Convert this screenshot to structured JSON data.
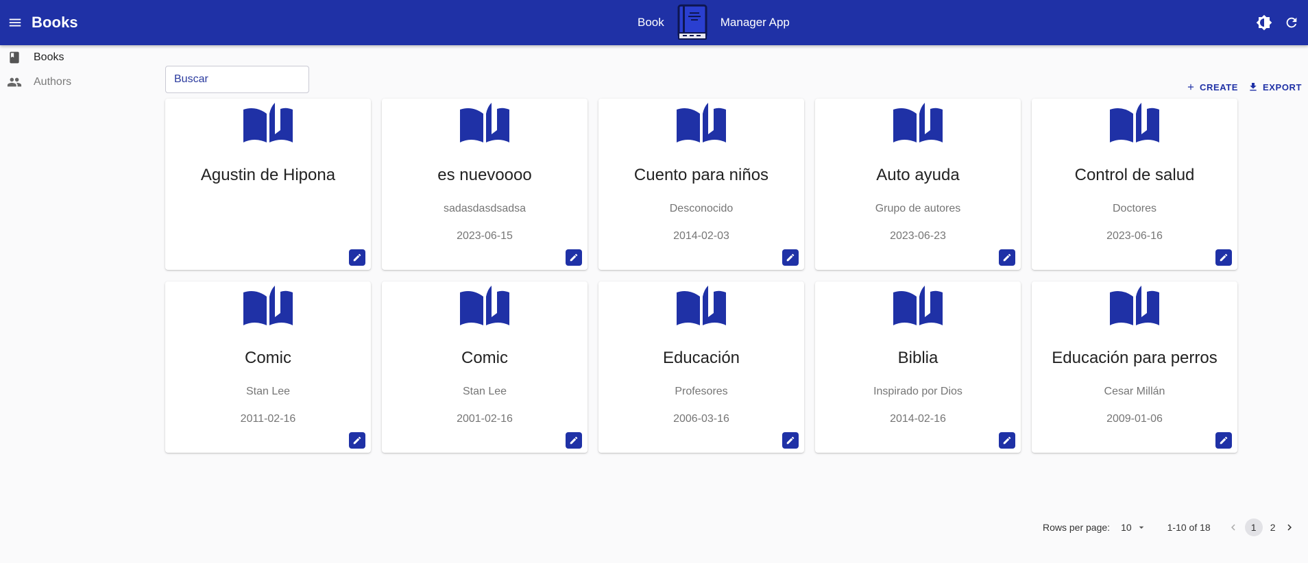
{
  "appbar": {
    "title": "Books",
    "center_left": "Book",
    "center_right": "Manager App",
    "brand_color": "#1f31a6"
  },
  "sidebar": {
    "items": [
      {
        "label": "Books",
        "icon": "book-icon"
      },
      {
        "label": "Authors",
        "icon": "people-icon"
      }
    ]
  },
  "search": {
    "placeholder": "Buscar"
  },
  "actions": {
    "create": "CREATE",
    "export": "EXPORT"
  },
  "books": [
    {
      "title": "Agustin de Hipona",
      "author": "",
      "date": ""
    },
    {
      "title": "es nuevoooo",
      "author": "sadasdasdsadsa",
      "date": "2023-06-15"
    },
    {
      "title": "Cuento para niños",
      "author": "Desconocido",
      "date": "2014-02-03"
    },
    {
      "title": "Auto ayuda",
      "author": "Grupo de autores",
      "date": "2023-06-23"
    },
    {
      "title": "Control de salud",
      "author": "Doctores",
      "date": "2023-06-16"
    },
    {
      "title": "Comic",
      "author": "Stan Lee",
      "date": "2011-02-16"
    },
    {
      "title": "Comic",
      "author": "Stan Lee",
      "date": "2001-02-16"
    },
    {
      "title": "Educación",
      "author": "Profesores",
      "date": "2006-03-16"
    },
    {
      "title": "Biblia",
      "author": "Inspirado por Dios",
      "date": "2014-02-16"
    },
    {
      "title": "Educación para perros",
      "author": "Cesar Millán",
      "date": "2009-01-06"
    }
  ],
  "pagination": {
    "rows_label": "Rows per page:",
    "rows_value": "10",
    "range": "1-10 of 18",
    "pages": [
      "1",
      "2"
    ],
    "current_page": "1"
  }
}
